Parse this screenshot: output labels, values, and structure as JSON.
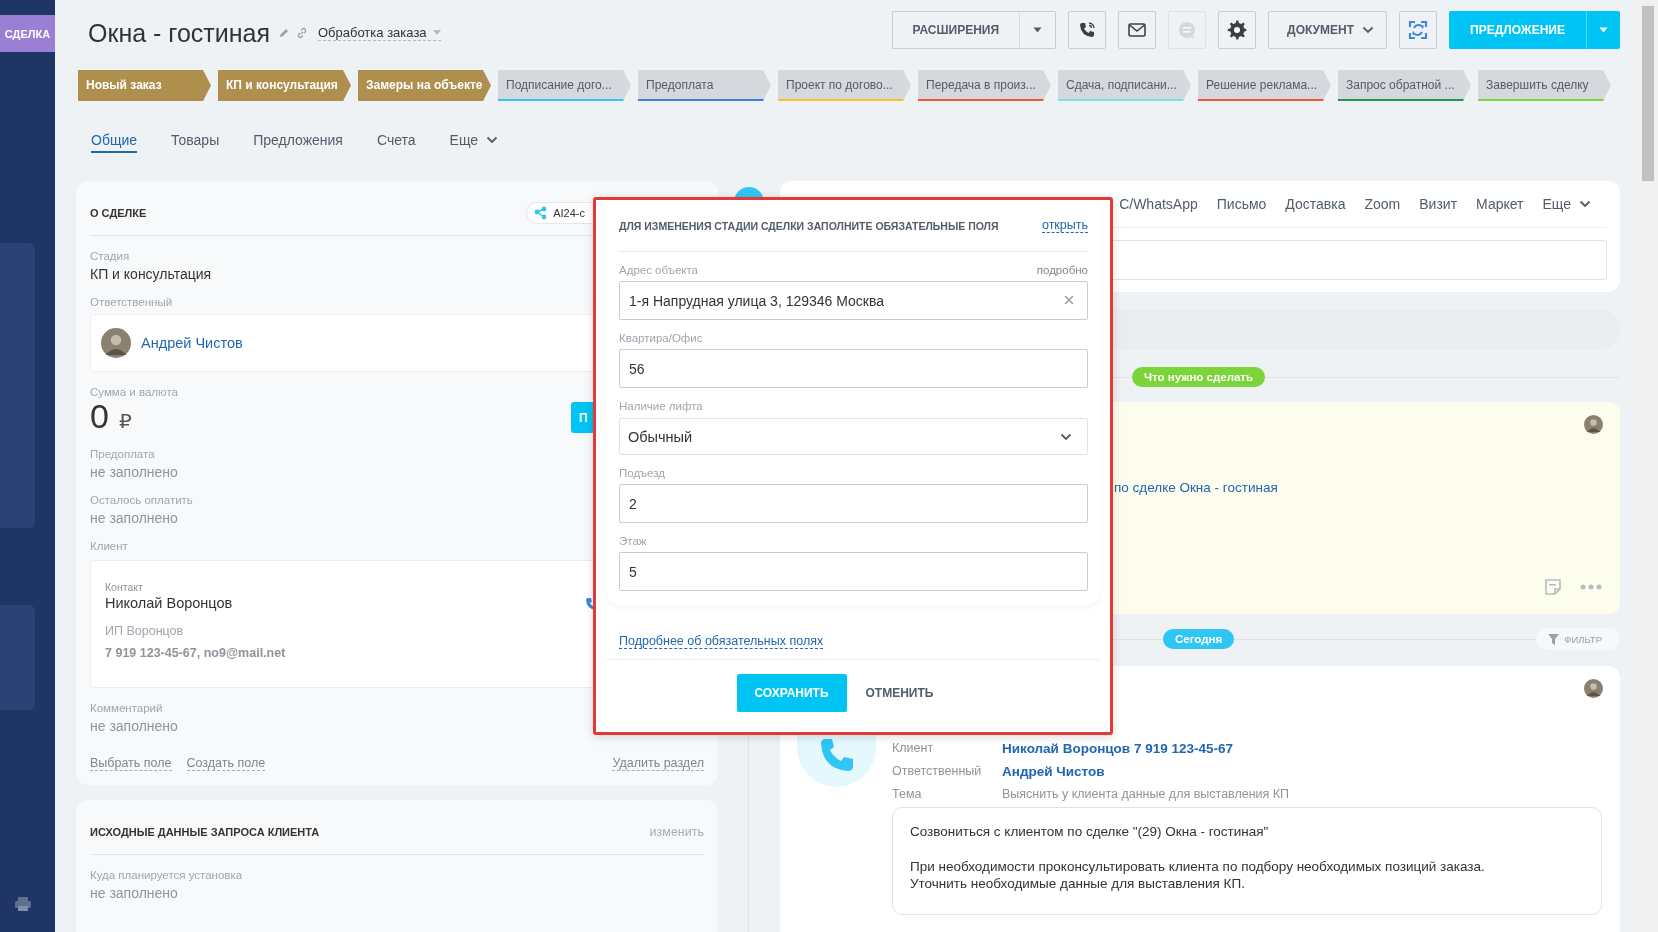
{
  "sidebar": {
    "badge": "СДЕЛКА"
  },
  "header": {
    "title": "Окна - гостиная",
    "pipeline": "Обработка заказа"
  },
  "toolbar": [
    {
      "kind": "split",
      "label": "РАСШИРЕНИЯ"
    },
    {
      "kind": "phone",
      "disabled": false
    },
    {
      "kind": "mail",
      "disabled": false
    },
    {
      "kind": "chat",
      "disabled": true
    },
    {
      "kind": "settings",
      "disabled": false
    },
    {
      "kind": "dropdown",
      "label": "ДОКУМЕНТ"
    },
    {
      "kind": "sync",
      "disabled": false
    },
    {
      "kind": "primary",
      "label": "ПРЕДЛОЖЕНИЕ"
    }
  ],
  "stages": [
    {
      "label": "Новый заказ",
      "done": true
    },
    {
      "label": "КП и консультация",
      "done": true
    },
    {
      "label": "Замеры на объекте",
      "done": true
    },
    {
      "label": "Подписание дого...",
      "done": false,
      "color": "#2fc6f6"
    },
    {
      "label": "Предоплата",
      "done": false,
      "color": "#3e7ee0"
    },
    {
      "label": "Проект по догово...",
      "done": false,
      "color": "#f5c228"
    },
    {
      "label": "Передача в произ...",
      "done": false,
      "color": "#f0573a"
    },
    {
      "label": "Сдача, подписани...",
      "done": false,
      "color": "#7fdcea"
    },
    {
      "label": "Решение реклама...",
      "done": false,
      "color": "#f0573a"
    },
    {
      "label": "Запрос обратной ...",
      "done": false,
      "color": "#1a9a4a"
    },
    {
      "label": "Завершить сделку",
      "done": false,
      "color": "#7bd43a"
    }
  ],
  "tabs": [
    {
      "label": "Общие",
      "selected": true,
      "kind": "tab"
    },
    {
      "label": "Товары",
      "selected": false,
      "kind": "tab"
    },
    {
      "label": "Предложения",
      "selected": false,
      "kind": "tab"
    },
    {
      "label": "Счета",
      "selected": false,
      "kind": "tab"
    },
    {
      "label": "Еще",
      "selected": false,
      "kind": "menu"
    }
  ],
  "deal_card": {
    "title": "О СДЕЛКЕ",
    "badge": "AI24-c",
    "stage": {
      "label": "Стадия",
      "value": "КП и консультация"
    },
    "responsible": {
      "label": "Ответственный",
      "name": "Андрей Чистов"
    },
    "amount": {
      "label": "Сумма и валюта",
      "value": "0",
      "currency": "₽",
      "button": "П"
    },
    "prepayment": {
      "label": "Предоплата",
      "value": "не заполнено"
    },
    "remaining": {
      "label": "Осталось оплатить",
      "value": "не заполнено"
    },
    "client": {
      "label": "Клиент",
      "contact_label": "Контакт",
      "name": "Николай Воронцов",
      "company": "ИП Воронцов",
      "contacts": "7 919 123-45-67, no9@mail.net"
    },
    "comment": {
      "label": "Комментарий",
      "value": "не заполнено"
    },
    "links": [
      "Выбрать поле",
      "Создать поле"
    ],
    "delete_link": "Удалить раздел"
  },
  "request_card": {
    "title": "ИСХОДНЫЕ ДАННЫЕ ЗАПРОСА КЛИЕНТА",
    "edit": "изменить",
    "fields": [
      {
        "label": "Куда планируется установка",
        "value": "не заполнено"
      }
    ]
  },
  "activity_tabs": [
    {
      "label": "C/WhatsApp",
      "kind": "tab"
    },
    {
      "label": "Письмо",
      "kind": "tab"
    },
    {
      "label": "Доставка",
      "kind": "tab"
    },
    {
      "label": "Zoom",
      "kind": "tab"
    },
    {
      "label": "Визит",
      "kind": "tab"
    },
    {
      "label": "Маркет",
      "kind": "tab"
    },
    {
      "label": "Еще",
      "kind": "menu"
    }
  ],
  "todo": {
    "badge": "Что нужно сделать",
    "text": "по сделке Окна - гостиная"
  },
  "history": {
    "badge": "Сегодня",
    "filter": "ФИЛЬТР"
  },
  "call_card": {
    "rows": [
      {
        "label": "Клиент",
        "value": "Николай Воронцов 7 919 123-45-67",
        "kind": "link"
      },
      {
        "label": "Ответственный",
        "value": "Андрей Чистов",
        "kind": "link"
      },
      {
        "label": "Тема",
        "value": "Выяснить у клиента данные для выставления КП",
        "kind": "text"
      }
    ],
    "comment": [
      "Созвониться с клиентом по сделке \"(29) Окна - гостиная\"",
      "При необходимости проконсультировать клиента по подбору необходимых позиций заказа.",
      "Уточнить необходимые данные для выставления КП."
    ]
  },
  "modal": {
    "title": "ДЛЯ ИЗМЕНЕНИЯ СТАДИИ СДЕЛКИ ЗАПОЛНИТЕ ОБЯЗАТЕЛЬНЫЕ ПОЛЯ",
    "open_link": "открыть",
    "fields": [
      {
        "label": "Адрес объекта",
        "aside": "подробно",
        "value": "1-я Напрудная улица 3, 129346 Москва",
        "kind": "text",
        "clearable": true
      },
      {
        "label": "Квартира/Офис",
        "value": "56",
        "kind": "text"
      },
      {
        "label": "Наличие лифта",
        "value": "Обычный",
        "kind": "select"
      },
      {
        "label": "Подъезд",
        "value": "2",
        "kind": "text"
      },
      {
        "label": "Этаж",
        "value": "5",
        "kind": "text"
      }
    ],
    "help_link": "Подробнее об обязательных полях",
    "save": "СОХРАНИТЬ",
    "cancel": "ОТМЕНИТЬ"
  }
}
